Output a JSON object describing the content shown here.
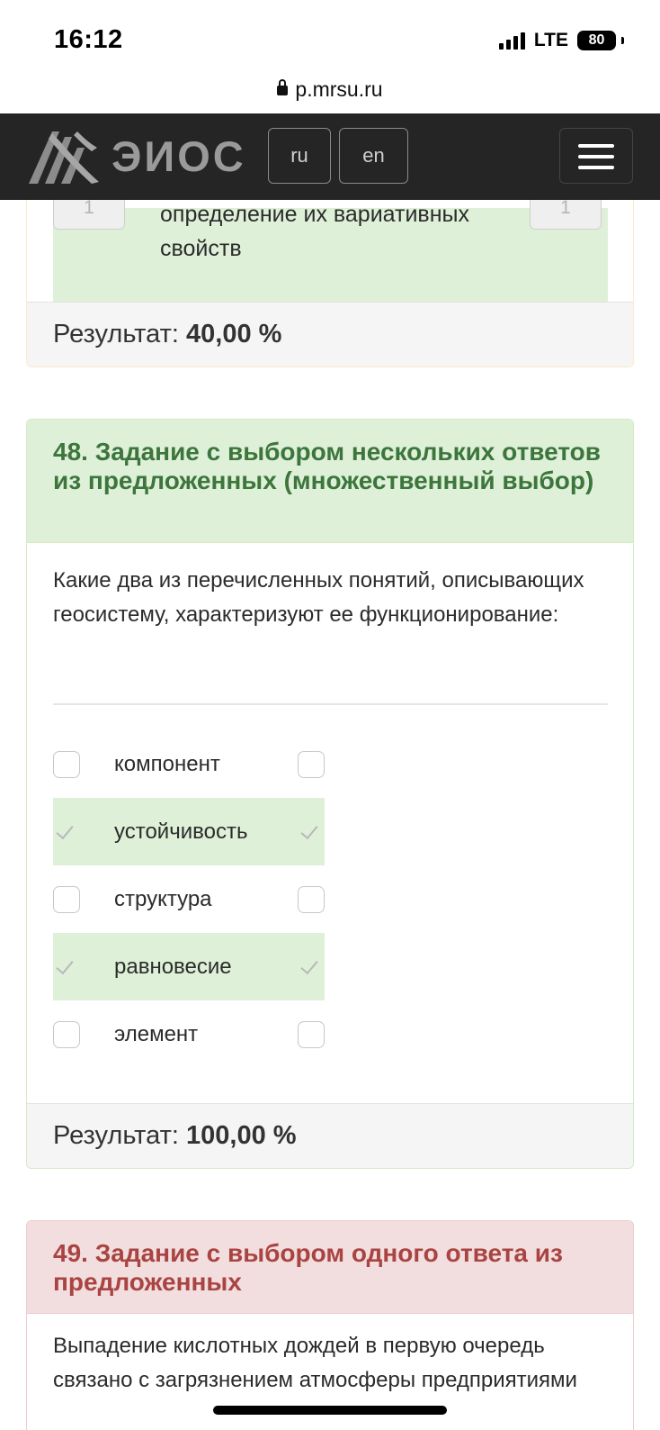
{
  "status_bar": {
    "time": "16:12",
    "network": "LTE",
    "battery": "80"
  },
  "browser": {
    "url": "p.mrsu.ru"
  },
  "navbar": {
    "brand": "ЭИОС",
    "lang_ru": "ru",
    "lang_en": "en",
    "menu_icon": "hamburger-menu-icon"
  },
  "prev_card": {
    "left_input": "1",
    "right_input": "1",
    "text": "определение их вариативных свойств",
    "result_label": "Результат:",
    "result_value": "40,00 %"
  },
  "task48": {
    "title": "48. Задание с выбором нескольких ответов из предложенных (множественный выбор)",
    "question": "Какие два из перечисленных понятий, описывающих геосистему, характеризуют ее функционирование:",
    "options": [
      {
        "label": "компонент",
        "checked": false,
        "correct": false
      },
      {
        "label": "устойчивость",
        "checked": true,
        "correct": true
      },
      {
        "label": "структура",
        "checked": false,
        "correct": false
      },
      {
        "label": "равновесие",
        "checked": true,
        "correct": true
      },
      {
        "label": "элемент",
        "checked": false,
        "correct": false
      }
    ],
    "result_label": "Результат:",
    "result_value": "100,00 %"
  },
  "task49": {
    "title": "49. Задание с выбором одного ответа из предложенных",
    "question": "Выпадение кислотных дождей в первую очередь связано с загрязнением атмосферы предприятиями"
  },
  "colors": {
    "success_bg": "#dff0d8",
    "success_text": "#3c763d",
    "danger_bg": "#f2dede",
    "danger_text": "#a94442",
    "navbar_bg": "#252525"
  }
}
